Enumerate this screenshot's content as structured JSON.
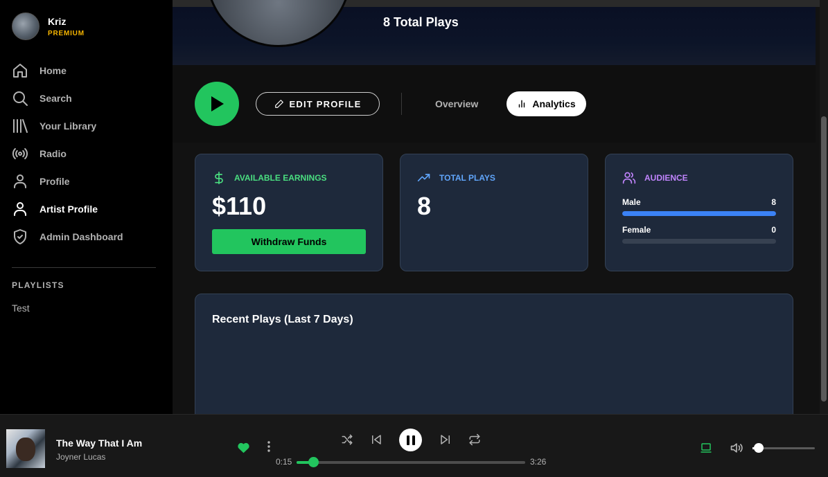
{
  "user": {
    "name": "Kriz",
    "tier": "PREMIUM"
  },
  "nav": [
    {
      "label": "Home",
      "icon": "home-icon"
    },
    {
      "label": "Search",
      "icon": "search-icon"
    },
    {
      "label": "Your Library",
      "icon": "library-icon"
    },
    {
      "label": "Radio",
      "icon": "radio-icon"
    },
    {
      "label": "Profile",
      "icon": "user-icon"
    },
    {
      "label": "Artist Profile",
      "icon": "user-icon",
      "active": true
    },
    {
      "label": "Admin Dashboard",
      "icon": "shield-check-icon"
    }
  ],
  "playlists": {
    "title": "PLAYLISTS",
    "items": [
      "Test"
    ]
  },
  "hero": {
    "plays_text": "8 Total Plays"
  },
  "actions": {
    "edit_label": "EDIT PROFILE",
    "tab_overview": "Overview",
    "tab_analytics": "Analytics"
  },
  "cards": {
    "earnings": {
      "title": "AVAILABLE EARNINGS",
      "value": "$110",
      "button": "Withdraw Funds",
      "color": "#4ade80"
    },
    "plays": {
      "title": "TOTAL PLAYS",
      "value": "8",
      "color": "#60a5fa"
    },
    "audience": {
      "title": "AUDIENCE",
      "color": "#c084fc",
      "rows": [
        {
          "label": "Male",
          "value": "8",
          "fraction": 1.0
        },
        {
          "label": "Female",
          "value": "0",
          "fraction": 0.0
        }
      ]
    }
  },
  "chart": {
    "title": "Recent Plays (Last 7 Days)"
  },
  "player": {
    "title": "The Way That I Am",
    "artist": "Joyner Lucas",
    "elapsed": "0:15",
    "duration": "3:26",
    "progress": 0.073,
    "volume": 0.05,
    "accent": "#22c55e"
  }
}
